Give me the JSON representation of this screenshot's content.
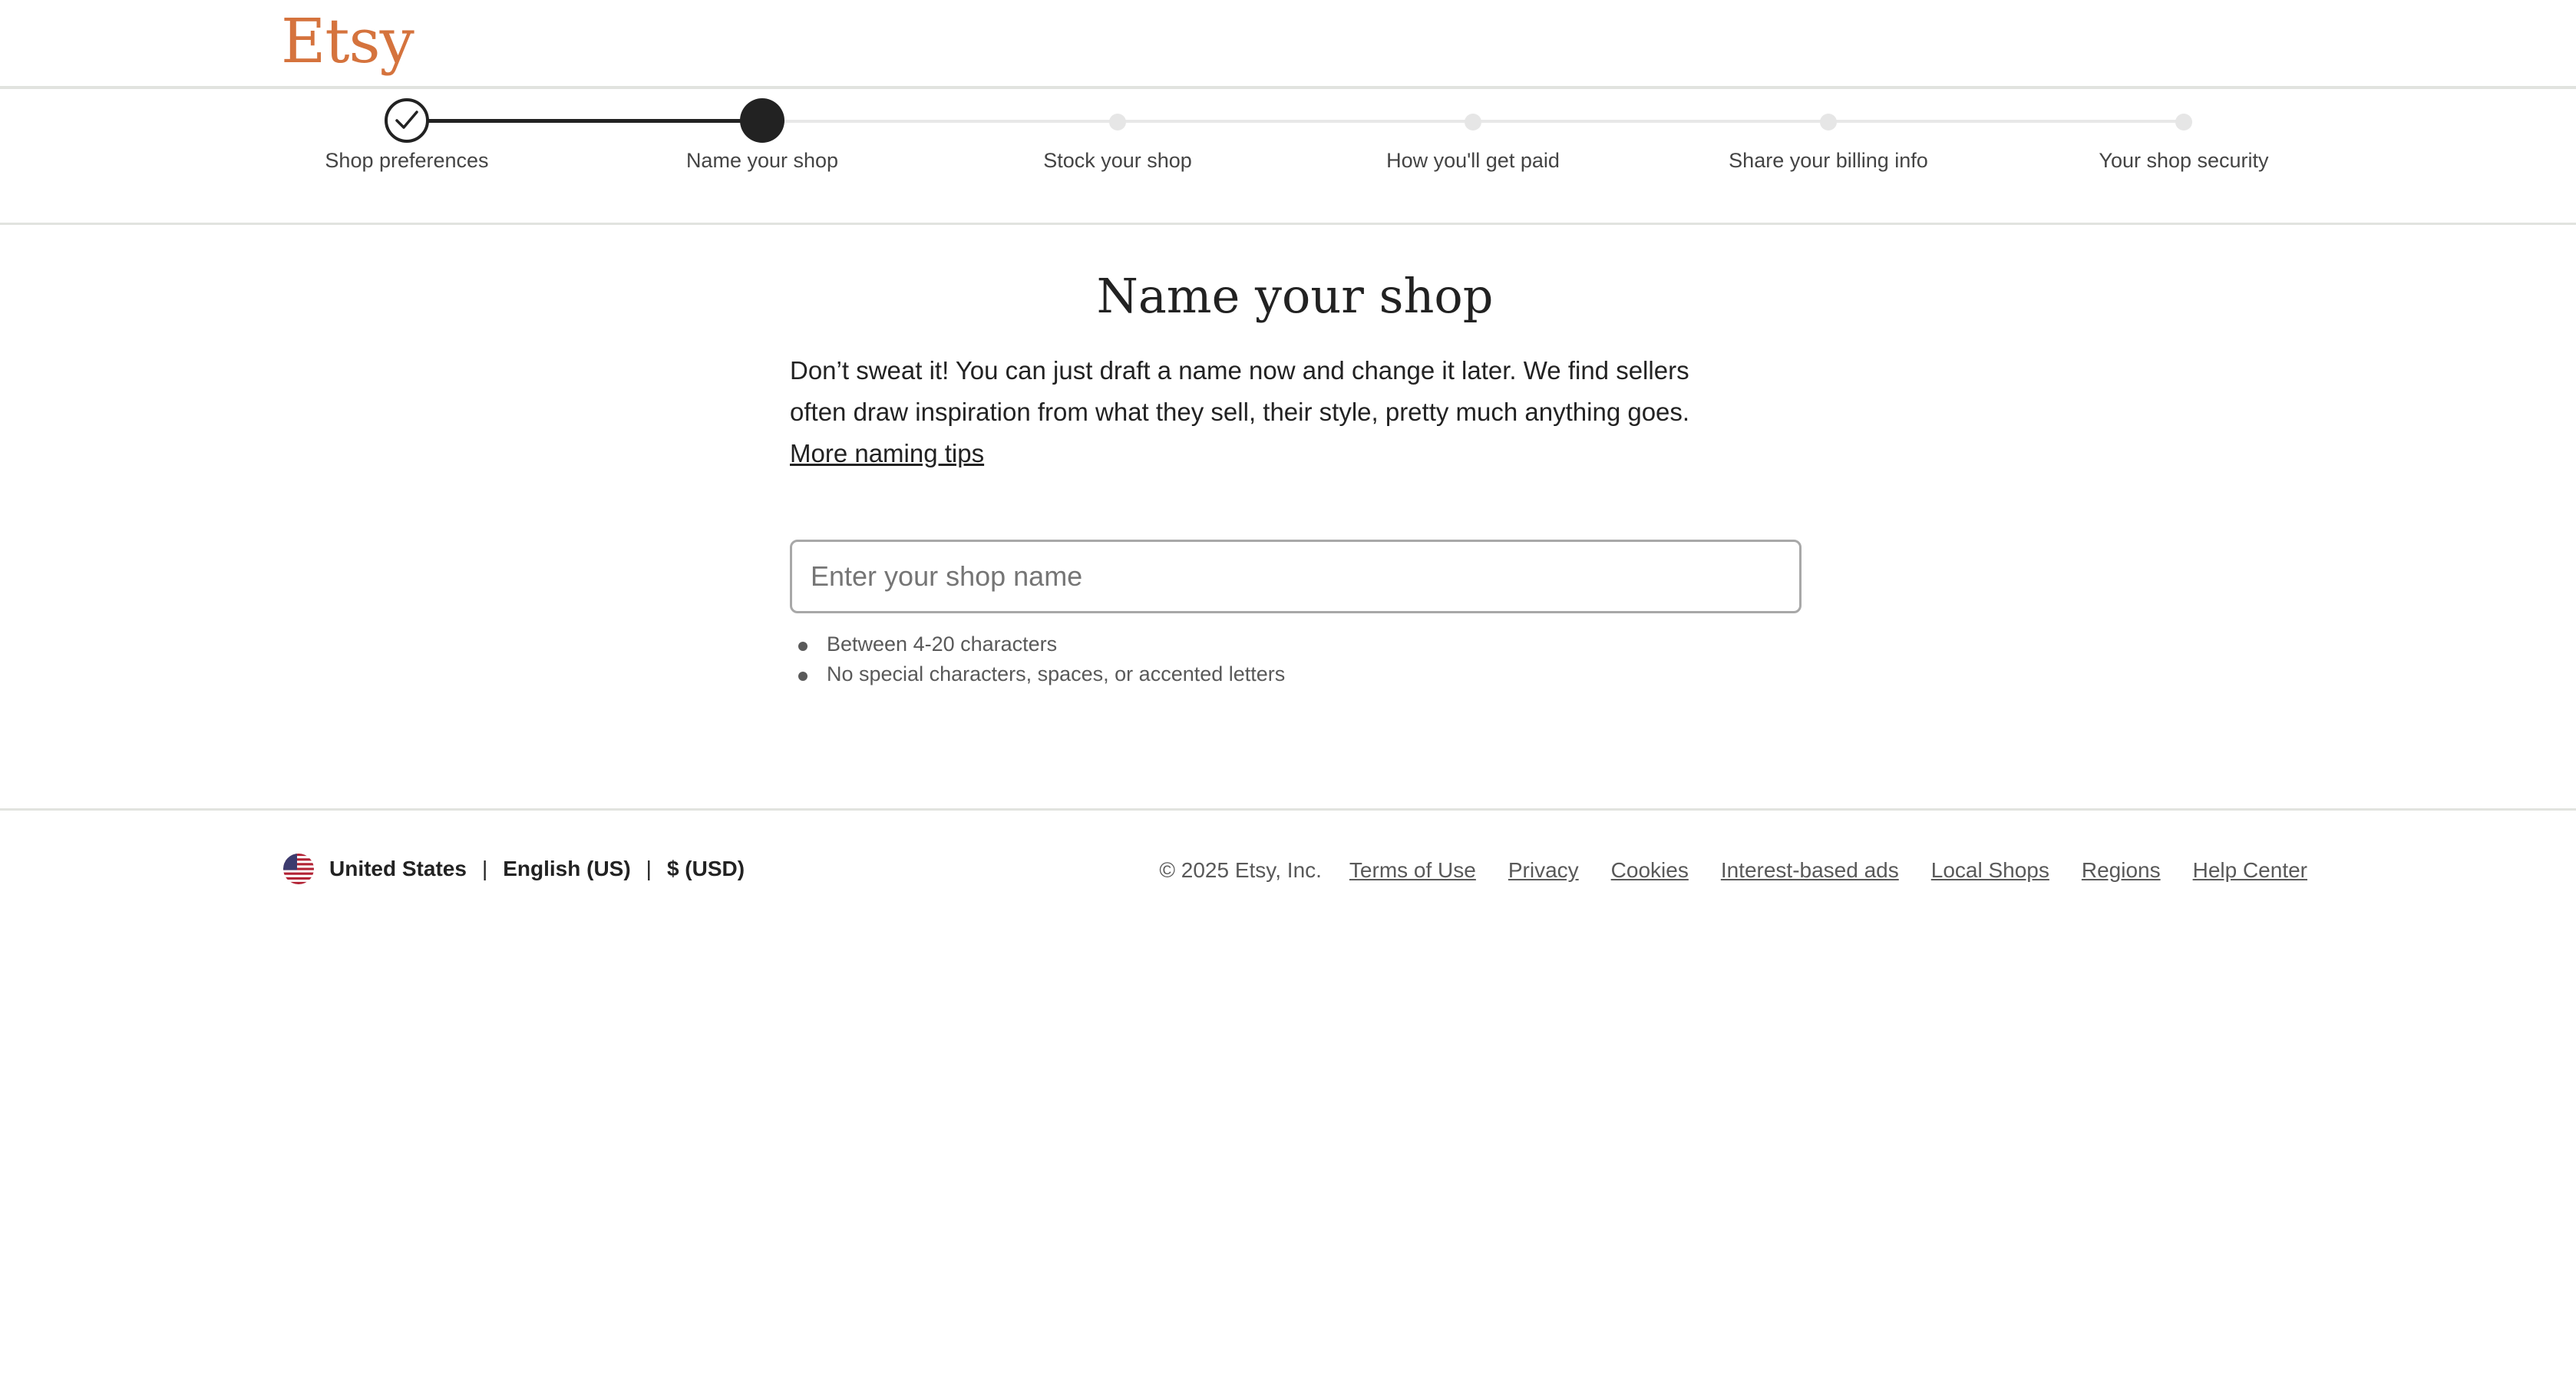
{
  "header": {
    "logo": "Etsy"
  },
  "progress": {
    "current_step": 2,
    "steps": [
      {
        "label": "Shop preferences",
        "state": "done"
      },
      {
        "label": "Name your shop",
        "state": "current"
      },
      {
        "label": "Stock your shop",
        "state": "upcoming"
      },
      {
        "label": "How you'll get paid",
        "state": "upcoming"
      },
      {
        "label": "Share your billing info",
        "state": "upcoming"
      },
      {
        "label": "Your shop security",
        "state": "upcoming"
      }
    ]
  },
  "main": {
    "title": "Name your shop",
    "intro_line1": "Don’t sweat it! You can just draft a name now and change it later. We find sellers",
    "intro_line2": "often draw inspiration from what they sell, their style, pretty much anything goes.",
    "tips_link": "More naming tips",
    "input": {
      "value": "",
      "placeholder": "Enter your shop name"
    },
    "rules": [
      "Between 4-20 characters",
      "No special characters, spaces, or accented letters"
    ]
  },
  "footer": {
    "flag_icon": "us-flag-icon",
    "country": "United States",
    "language": "English (US)",
    "currency": "$ (USD)",
    "separator": "|",
    "copyright": "© 2025 Etsy, Inc.",
    "links": [
      "Terms of Use",
      "Privacy",
      "Cookies",
      "Interest-based ads",
      "Local Shops",
      "Regions",
      "Help Center"
    ]
  },
  "colors": {
    "brand": "#d5733d",
    "text": "#222222",
    "muted": "#595959",
    "divider": "#e1e3df"
  }
}
